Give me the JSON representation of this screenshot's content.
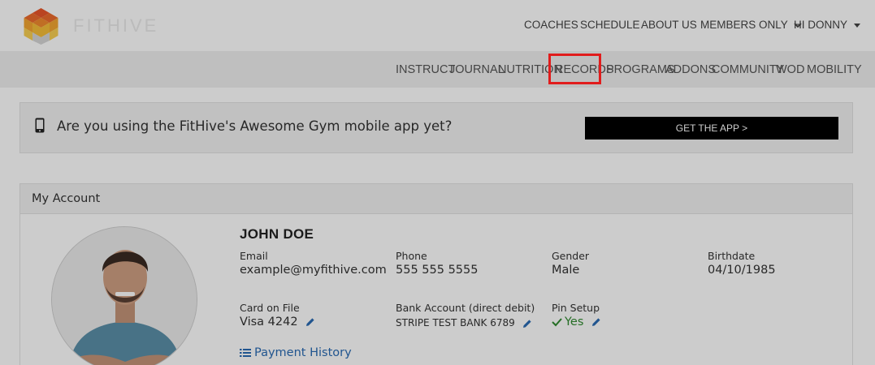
{
  "header": {
    "logo_text": "FITHIVE",
    "nav": [
      "COACHES",
      "SCHEDULE",
      "ABOUT US",
      "MEMBERS ONLY",
      "HI DONNY"
    ]
  },
  "subnav": [
    "INSTRUCT",
    "JOURNAL",
    "NUTRITION",
    "RECORDS",
    "PROGRAMS",
    "ADDONS",
    "COMMUNITY",
    "WOD",
    "MOBILITY"
  ],
  "highlighted_item": "RECORDS",
  "banner": {
    "text": "Are you using the FitHive's Awesome Gym mobile app yet?",
    "button": "GET THE APP >"
  },
  "account": {
    "title": "My Account",
    "name": "JOHN DOE",
    "fields": {
      "email_label": "Email",
      "email": "example@myfithive.com",
      "phone_label": "Phone",
      "phone": "555 555 5555",
      "gender_label": "Gender",
      "gender": "Male",
      "birthdate_label": "Birthdate",
      "birthdate": "04/10/1985",
      "card_label": "Card on File",
      "card": "Visa 4242",
      "bank_label": "Bank Account (direct debit)",
      "bank": "STRIPE TEST BANK 6789",
      "pin_label": "Pin Setup",
      "pin": "Yes"
    },
    "payment_history": "Payment History"
  },
  "colors": {
    "highlight": "#e11c1c",
    "link": "#2a6bb3",
    "success": "#2f8a2f",
    "button_bg": "#000000"
  }
}
